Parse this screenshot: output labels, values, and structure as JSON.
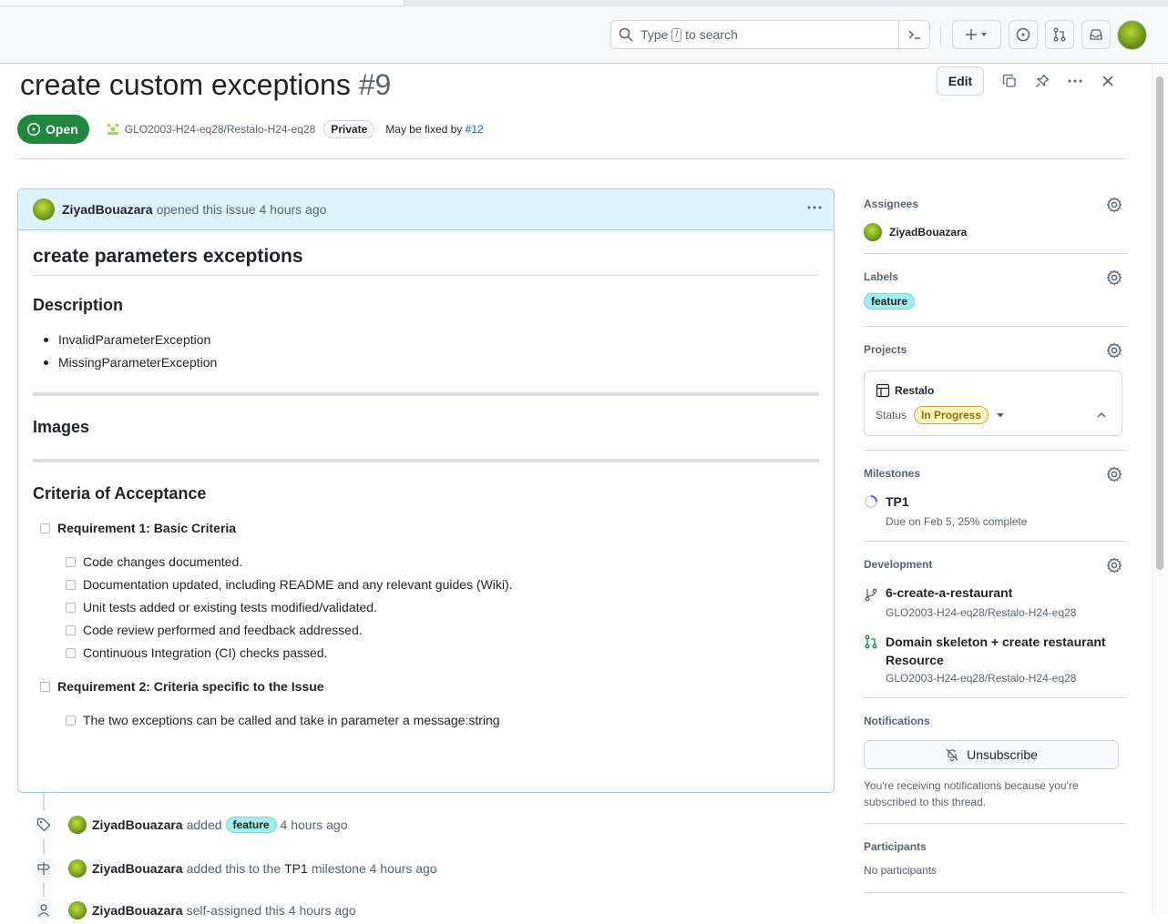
{
  "header": {
    "search_pre": "Type",
    "search_key": "/",
    "search_post": "to search"
  },
  "issue": {
    "title": "create custom exceptions",
    "number": "#9",
    "edit_label": "Edit",
    "state": "Open",
    "repo": "GLO2003-H24-eq28/Restalo-H24-eq28",
    "visibility": "Private",
    "fixed_by_text": "May be fixed by",
    "fixed_by_link": "#12"
  },
  "comment": {
    "author": "ZiyadBouazara",
    "action": "opened this issue 4 hours ago",
    "heading": "create parameters exceptions",
    "desc_heading": "Description",
    "desc_items": [
      "InvalidParameterException",
      "MissingParameterException"
    ],
    "images_heading": "Images",
    "criteria_heading": "Criteria of Acceptance",
    "req1": "Requirement 1: Basic Criteria",
    "req1_items": [
      "Code changes documented.",
      "Documentation updated, including README and any relevant guides (Wiki).",
      "Unit tests added or existing tests modified/validated.",
      "Code review performed and feedback addressed.",
      "Continuous Integration (CI) checks passed."
    ],
    "req2": "Requirement 2: Criteria specific to the Issue",
    "req2_items": [
      "The two exceptions can be called and take in parameter a message:string"
    ]
  },
  "timeline": [
    {
      "author": "ZiyadBouazara",
      "pre": "added",
      "label": "feature",
      "post": "4 hours ago"
    },
    {
      "author": "ZiyadBouazara",
      "pre": "added this to the",
      "milestone": "TP1",
      "post": "milestone 4 hours ago"
    },
    {
      "author": "ZiyadBouazara",
      "pre": "self-assigned this",
      "post": "4 hours ago"
    }
  ],
  "sidebar": {
    "assignees_title": "Assignees",
    "assignee": "ZiyadBouazara",
    "labels_title": "Labels",
    "label": "feature",
    "projects_title": "Projects",
    "project_name": "Restalo",
    "status_label": "Status",
    "status_value": "In Progress",
    "milestones_title": "Milestones",
    "milestone_name": "TP1",
    "milestone_due": "Due on Feb 5, 25% complete",
    "development_title": "Development",
    "branch_name": "6-create-a-restaurant",
    "branch_repo": "GLO2003-H24-eq28/Restalo-H24-eq28",
    "pr_name": "Domain skeleton + create restaurant Resource",
    "pr_repo": "GLO2003-H24-eq28/Restalo-H24-eq28",
    "notifications_title": "Notifications",
    "unsubscribe_label": "Unsubscribe",
    "notif_reason": "You're receiving notifications because you're subscribed to this thread.",
    "participants_title": "Participants",
    "participants_text": "No participants"
  },
  "colors": {
    "open_green": "#1f883d",
    "link_blue": "#0969da",
    "label_feature": "#a2eeef",
    "in_progress": "#fff8c5"
  }
}
